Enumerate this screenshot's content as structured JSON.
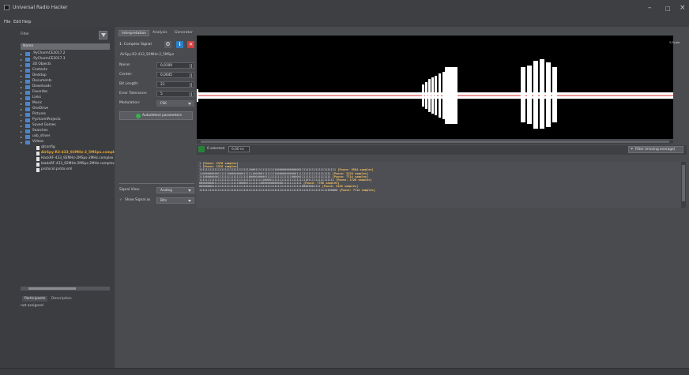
{
  "window": {
    "title": "Universal Radio Hacker",
    "controls": [
      "–",
      "□",
      "×"
    ]
  },
  "menu": [
    "File",
    "Edit",
    "Help"
  ],
  "file_tree": {
    "filter_placeholder": "Filter",
    "header": "Name",
    "items": [
      {
        "label": ".PyCharmCE2017.2",
        "type": "folder"
      },
      {
        "label": ".PyCharmCE2017.3",
        "type": "folder"
      },
      {
        "label": "3D Objects",
        "type": "folder"
      },
      {
        "label": "Contacts",
        "type": "folder"
      },
      {
        "label": "Desktop",
        "type": "folder"
      },
      {
        "label": "Documents",
        "type": "folder"
      },
      {
        "label": "Downloads",
        "type": "folder"
      },
      {
        "label": "Favorites",
        "type": "folder"
      },
      {
        "label": "Links",
        "type": "folder"
      },
      {
        "label": "Music",
        "type": "folder"
      },
      {
        "label": "OneDrive",
        "type": "folder"
      },
      {
        "label": "Pictures",
        "type": "folder"
      },
      {
        "label": "PycharmProjects",
        "type": "folder"
      },
      {
        "label": "Saved Games",
        "type": "folder"
      },
      {
        "label": "Searches",
        "type": "folder"
      },
      {
        "label": "usb_driver",
        "type": "folder"
      },
      {
        "label": "Videos",
        "type": "folder"
      }
    ],
    "children": [
      {
        "label": "qtconfig",
        "state": "normal"
      },
      {
        "label": "AirSpy-R2-433_92MHz-2_5MSps.complex",
        "state": "active"
      },
      {
        "label": "HackRF-433_92MHz-2MSps-2MHz.complex",
        "state": "normal"
      },
      {
        "label": "bladeRF-433_92MHz-2MSps-2MHz.complex",
        "state": "normal"
      },
      {
        "label": "protocol.proto.xml",
        "state": "normal"
      }
    ]
  },
  "side_tabs": [
    "Participants",
    "Description"
  ],
  "side_value": "not assigned",
  "tabs": [
    "Interpretation",
    "Analysis",
    "Generator"
  ],
  "signal": {
    "header": "1: Complex Signal",
    "name": "AirSpy-R2-433_92MHz-2_5MSps",
    "params": [
      {
        "label": "Noise:",
        "value": "0,0109"
      },
      {
        "label": "Center:",
        "value": "0,0045"
      },
      {
        "label": "Bit Length:",
        "value": "21"
      },
      {
        "label": "Error Tolerance:",
        "value": "5"
      }
    ],
    "modulation_label": "Modulation:",
    "modulation": "FSK",
    "autodetect": "Autodetect parameters",
    "view_label": "Signal View:",
    "view": "Analog",
    "show_label": "Show Signal as",
    "show": "Bits",
    "show_checked": "✓"
  },
  "plot": {
    "scale": "Y-Scale"
  },
  "selection": {
    "selected": "0 selected",
    "time": "0,00 ns",
    "filter": "Filter (moving average)"
  },
  "bits": [
    {
      "bits": "1",
      "tag": "[Pause: 2376 samples]"
    },
    {
      "bits": "1",
      "tag": "[Pause: 2376 samples]"
    },
    {
      "bits": "11111111111111111111111111111100011111111111100000000000000111111111111111111111",
      "tag": "[Pause: 9504 samples]"
    },
    {
      "bits": "11000000000111111000000000111111000001111111100000000000011111111111111111111",
      "tag": "[Pause: 3120 samples]"
    },
    {
      "bits": "11100000000111111111111111111000000000011111111111111100000111111111111111111",
      "tag": "[Pause: 7714 samples]"
    },
    {
      "bits": "1111111111111111111111111111111111111100001111111111111111111110111111111111111",
      "tag": "[Pause: 1726 samples]"
    },
    {
      "bits": "000000000111111111111110000011111111000000000000011111111111",
      "tag": "[Pause: 7760 samples]"
    },
    {
      "bits": "00000000111111111111111111111111111111111111111111111111111100000001111",
      "tag": "[Pause: 3120 samples]"
    },
    {
      "bits": "111111111111111111111111111111111111111111111111111111111111111111111111111100000",
      "tag": "[Pause: 7714 samples]"
    }
  ],
  "colors": {
    "accent": "#e8a42b",
    "signal": "#ffffff",
    "center_line": "#e05a5a",
    "plot_bg": "#000000"
  },
  "icons": [
    "app-icon",
    "filter-icon",
    "gear-icon",
    "info-icon",
    "close-icon",
    "checkmark-icon",
    "filter-funnel-icon",
    "folder-icon",
    "file-icon"
  ]
}
